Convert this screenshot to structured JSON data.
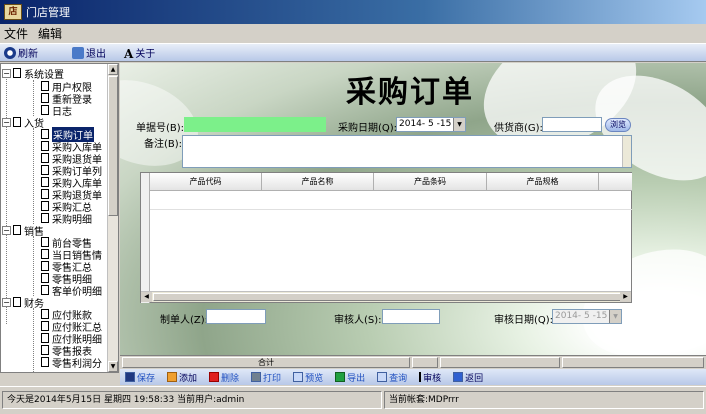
{
  "window": {
    "title": "门店管理",
    "app_icon_text": "店"
  },
  "menu": {
    "items": [
      "文件",
      "编辑"
    ]
  },
  "toolbar": {
    "refresh": "刷新",
    "exit": "退出",
    "about_glyph": "A",
    "about": "关于"
  },
  "tree": {
    "groups": [
      {
        "label": "系统设置",
        "expander": "−",
        "items": [
          "用户权限",
          "重新登录",
          "日志"
        ]
      },
      {
        "label": "入货",
        "expander": "−",
        "items": [
          "采购订单",
          "采购入库单",
          "采购退货单",
          "采购订单列",
          "采购入库单",
          "采购退货单",
          "采购汇总",
          "采购明细"
        ]
      },
      {
        "label": "销售",
        "expander": "−",
        "items": [
          "前台零售",
          "当日销售情",
          "零售汇总",
          "零售明细",
          "客单价明细"
        ]
      },
      {
        "label": "财务",
        "expander": "−",
        "items": [
          "应付账款",
          "应付账汇总",
          "应付账明细",
          "零售报表",
          "零售利润分"
        ]
      }
    ],
    "selected": "采购订单"
  },
  "form": {
    "title": "采购订单",
    "order_no_label": "单据号(B):",
    "order_no_value": "",
    "purchase_date_label": "采购日期(Q):",
    "purchase_date_value": "2014- 5 -15",
    "supplier_label": "供货商(G):",
    "supplier_value": "",
    "browse_label": "浏览",
    "remarks_label": "备注(B):",
    "remarks_value": "",
    "maker_label": "制单人(Z):",
    "maker_value": "",
    "reviewer_label": "审核人(S):",
    "reviewer_value": "",
    "review_date_label": "审核日期(Q):",
    "review_date_value": "2014- 5 -15"
  },
  "grid": {
    "columns": [
      "产品代码",
      "产品名称",
      "产品条码",
      "产品规格"
    ]
  },
  "summary": {
    "total_label": "合计"
  },
  "bottom_toolbar": {
    "save": "保存",
    "add": "添加",
    "delete": "删除",
    "print": "打印",
    "preview": "预览",
    "export": "导出",
    "query": "查询",
    "review": "审核",
    "back": "返回"
  },
  "status": {
    "datetime": "今天是2014年5月15日  星期四  19:58:33  当前用户:admin",
    "account": "当前帐套:MDPrrr"
  },
  "colors": {
    "selection": "#0a246a",
    "order_no_field": "#7cf08a",
    "titlebar": "#0a246a"
  }
}
